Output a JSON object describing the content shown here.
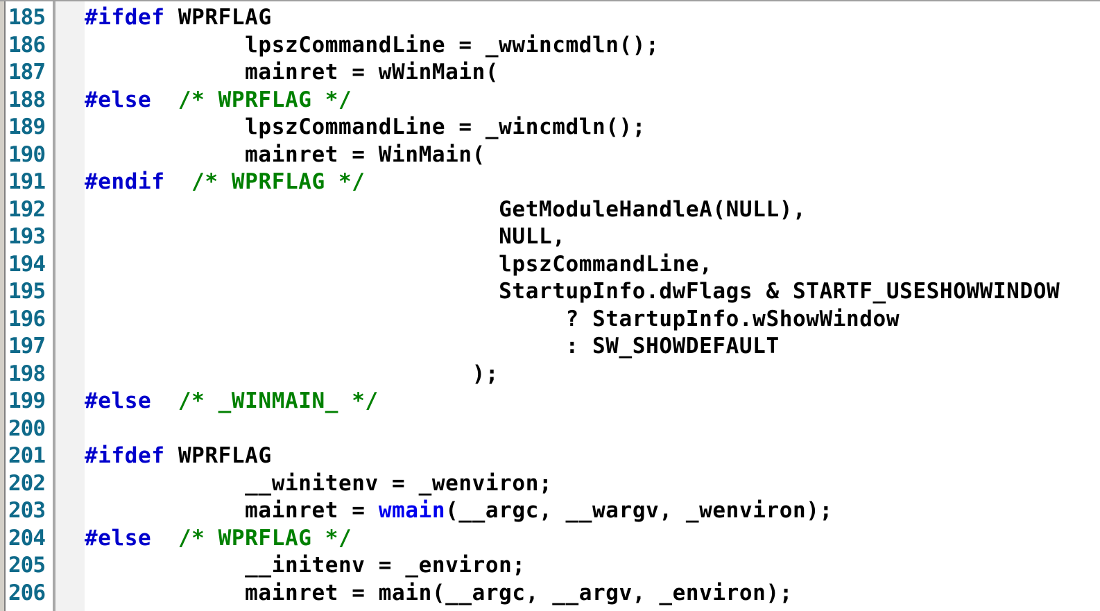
{
  "editor": {
    "lines": [
      {
        "num": "185",
        "tokens": [
          {
            "t": "#ifdef",
            "k": "directive"
          },
          {
            "t": " WPRFLAG",
            "k": "plain"
          }
        ]
      },
      {
        "num": "186",
        "tokens": [
          {
            "t": "            lpszCommandLine = _wwincmdln();",
            "k": "plain"
          }
        ]
      },
      {
        "num": "187",
        "tokens": [
          {
            "t": "            mainret = wWinMain(",
            "k": "plain"
          }
        ]
      },
      {
        "num": "188",
        "tokens": [
          {
            "t": "#else",
            "k": "directive"
          },
          {
            "t": "  /* WPRFLAG */",
            "k": "comment"
          }
        ]
      },
      {
        "num": "189",
        "tokens": [
          {
            "t": "            lpszCommandLine = _wincmdln();",
            "k": "plain"
          }
        ]
      },
      {
        "num": "190",
        "tokens": [
          {
            "t": "            mainret = WinMain(",
            "k": "plain"
          }
        ]
      },
      {
        "num": "191",
        "tokens": [
          {
            "t": "#endif",
            "k": "directive"
          },
          {
            "t": "  /* WPRFLAG */",
            "k": "comment"
          }
        ]
      },
      {
        "num": "192",
        "tokens": [
          {
            "t": "                               GetModuleHandleA(NULL),",
            "k": "plain"
          }
        ]
      },
      {
        "num": "193",
        "tokens": [
          {
            "t": "                               NULL,",
            "k": "plain"
          }
        ]
      },
      {
        "num": "194",
        "tokens": [
          {
            "t": "                               lpszCommandLine,",
            "k": "plain"
          }
        ]
      },
      {
        "num": "195",
        "tokens": [
          {
            "t": "                               StartupInfo.dwFlags & STARTF_USESHOWWINDOW",
            "k": "plain"
          }
        ]
      },
      {
        "num": "196",
        "tokens": [
          {
            "t": "                                    ? StartupInfo.wShowWindow",
            "k": "plain"
          }
        ]
      },
      {
        "num": "197",
        "tokens": [
          {
            "t": "                                    : SW_SHOWDEFAULT",
            "k": "plain"
          }
        ]
      },
      {
        "num": "198",
        "tokens": [
          {
            "t": "                             );",
            "k": "plain"
          }
        ]
      },
      {
        "num": "199",
        "tokens": [
          {
            "t": "#else",
            "k": "directive"
          },
          {
            "t": "  /* _WINMAIN_ */",
            "k": "comment"
          }
        ]
      },
      {
        "num": "200",
        "tokens": []
      },
      {
        "num": "201",
        "tokens": [
          {
            "t": "#ifdef",
            "k": "directive"
          },
          {
            "t": " WPRFLAG",
            "k": "plain"
          }
        ]
      },
      {
        "num": "202",
        "tokens": [
          {
            "t": "            __winitenv = _wenviron;",
            "k": "plain"
          }
        ]
      },
      {
        "num": "203",
        "tokens": [
          {
            "t": "            mainret = ",
            "k": "plain"
          },
          {
            "t": "wmain",
            "k": "func"
          },
          {
            "t": "(__argc, __wargv, _wenviron);",
            "k": "plain"
          }
        ]
      },
      {
        "num": "204",
        "tokens": [
          {
            "t": "#else",
            "k": "directive"
          },
          {
            "t": "  /* WPRFLAG */",
            "k": "comment"
          }
        ]
      },
      {
        "num": "205",
        "tokens": [
          {
            "t": "            __initenv = _environ;",
            "k": "plain"
          }
        ]
      },
      {
        "num": "206",
        "tokens": [
          {
            "t": "            mainret = main(__argc, __argv, _environ);",
            "k": "plain"
          }
        ]
      }
    ]
  },
  "colors": {
    "line_number": "#0f6a8a",
    "directive": "#0000cc",
    "comment": "#008000",
    "function": "#0000ee",
    "text": "#000000"
  }
}
